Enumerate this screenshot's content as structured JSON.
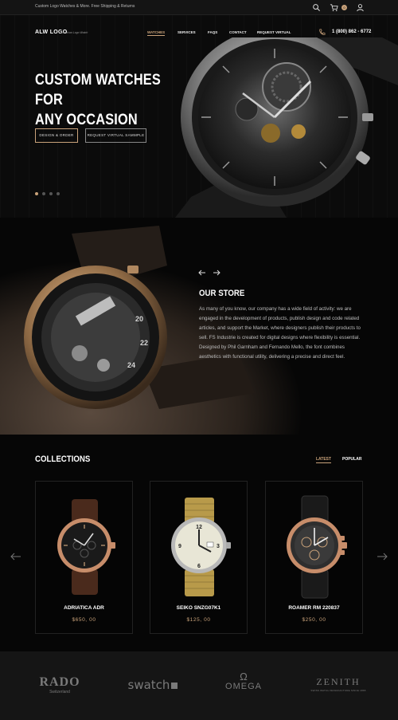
{
  "topbar": {
    "promo": "Custom Logo Watches & More. Free Shipping & Returns",
    "icons": [
      "search-icon",
      "cart-icon",
      "user-icon"
    ],
    "cart_count": "0"
  },
  "header": {
    "logo": "ALW LOGO",
    "logo_tagline": "American Logo Watch",
    "nav": [
      "WATCHES",
      "SERVICES",
      "FAQS",
      "CONTACT",
      "REQUEST VIRTUAL"
    ],
    "phone": "1 (800) 862 - 6772"
  },
  "hero": {
    "title_line1": "CUSTOM WATCHES FOR",
    "title_line2": "ANY OCCASION",
    "primary_button": "DESIGN & ORDER",
    "secondary_button": "REQUEST VIRTUAL SAMMPLE",
    "slides_total": 4,
    "slide_active": 1
  },
  "store": {
    "title": "OUR STORE",
    "text": "As many of you know, our company has a wide field of activity: we are engaged in the development of products, publish design and code related articles, and support the Market, where designers publish their products to sell. FS Industrie is created for digital designs where flexibility is essential. Designed by Phil Garnham and Fernando Mello, the font combines aesthetics with functional utility, delivering a precise and direct feel."
  },
  "collections": {
    "title": "COLLECTIONS",
    "tabs": [
      "LATEST",
      "POPULAR"
    ],
    "products": [
      {
        "name": "ADRIATICA ADR",
        "price": "$650, 00"
      },
      {
        "name": "SEIKO SNZG07K1",
        "price": "$125, 00"
      },
      {
        "name": "ROAMER RM 220837",
        "price": "$250, 00"
      }
    ]
  },
  "brands": {
    "rado": "RADO",
    "rado_sub": "Switzerland",
    "swatch": "swatch",
    "omega_symbol": "Ω",
    "omega": "OMEGA",
    "zenith": "ZENITH",
    "zenith_sub": "SWISS WATCH MANUFACTURE SINCE 1865"
  },
  "colors": {
    "accent": "#c9a27a",
    "background": "#0a0a0a",
    "footer": "#151515"
  }
}
